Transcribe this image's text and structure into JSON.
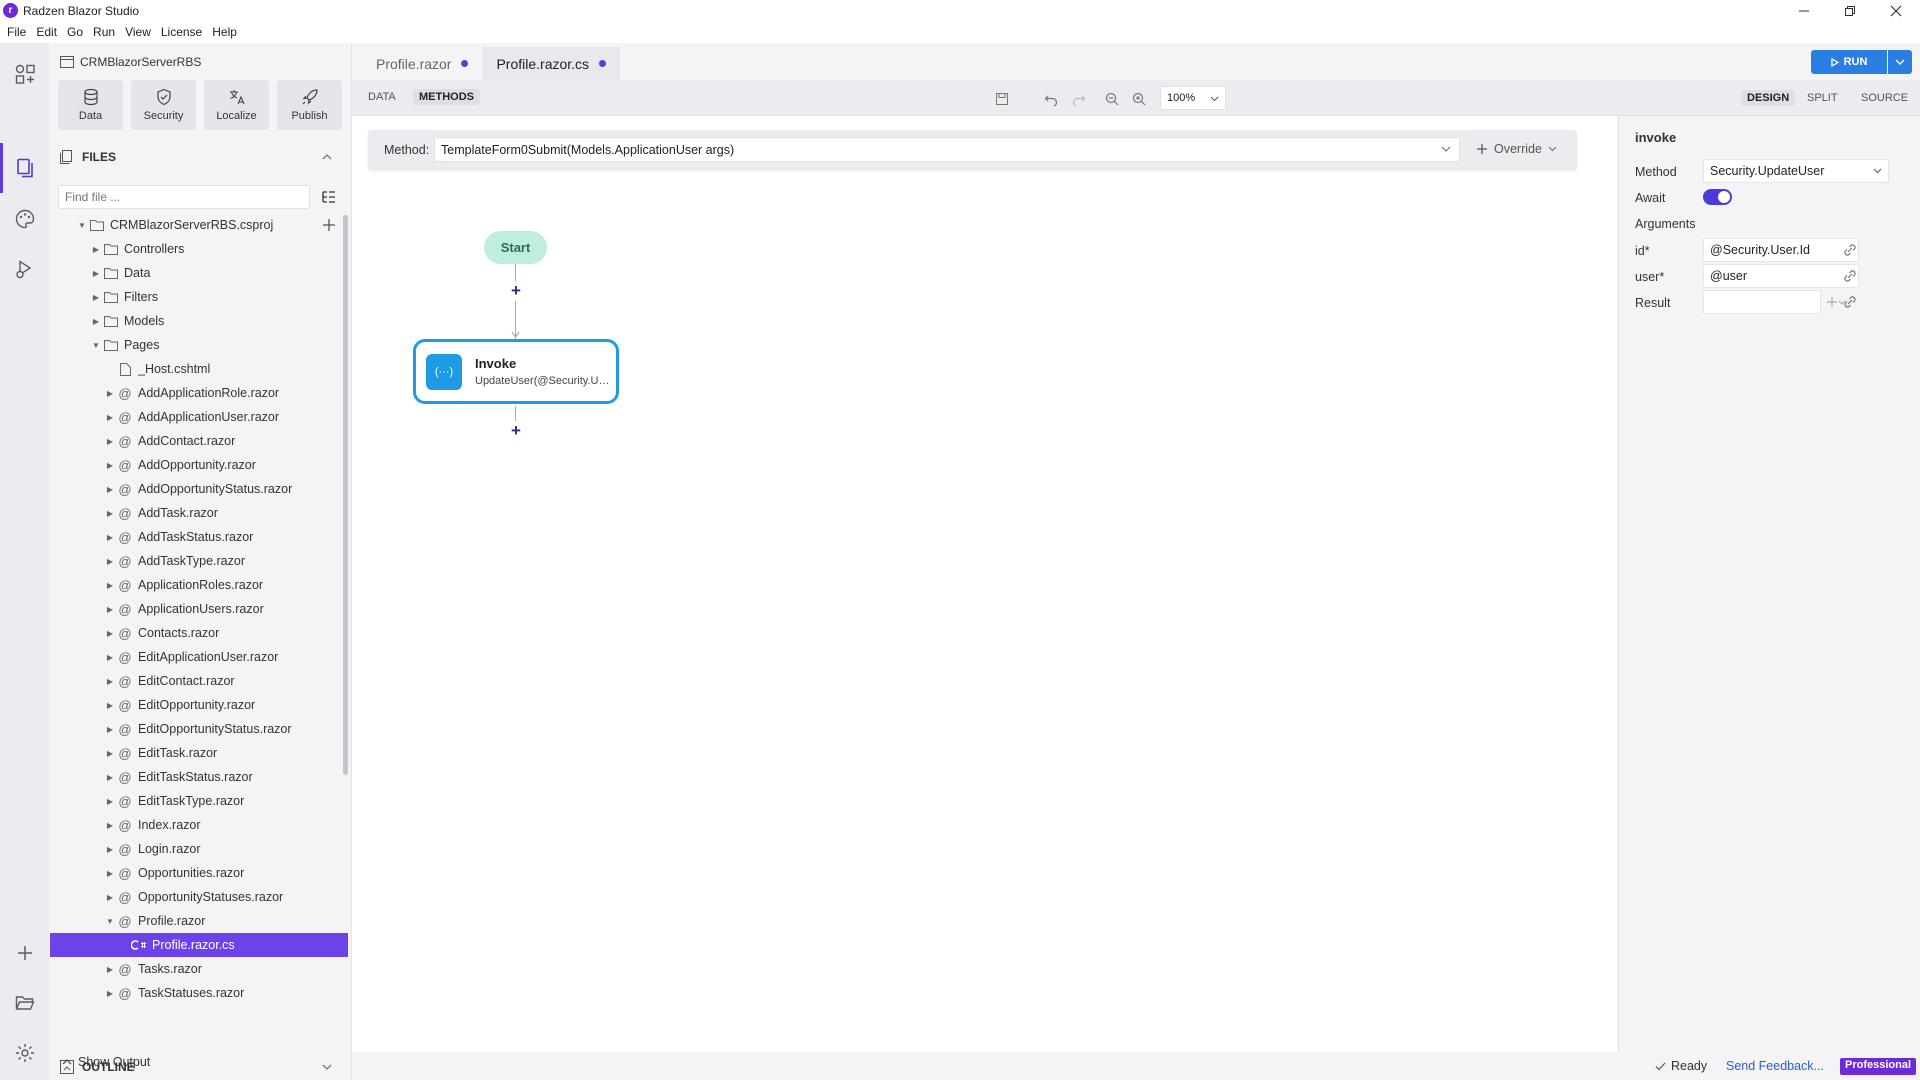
{
  "app": {
    "title": "Radzen Blazor Studio"
  },
  "menu": [
    "File",
    "Edit",
    "Go",
    "Run",
    "View",
    "License",
    "Help"
  ],
  "sidebar": {
    "project": "CRMBlazorServerRBS",
    "tools": [
      {
        "label": "Data",
        "icon": "database-icon"
      },
      {
        "label": "Security",
        "icon": "shield-icon"
      },
      {
        "label": "Localize",
        "icon": "translate-icon"
      },
      {
        "label": "Publish",
        "icon": "rocket-icon"
      }
    ],
    "files_header": "FILES",
    "find_placeholder": "Find file ...",
    "tree": [
      {
        "label": "CRMBlazorServerRBS.csproj",
        "kind": "project",
        "level": 0,
        "expanded": true
      },
      {
        "label": "Controllers",
        "kind": "folder",
        "level": 1
      },
      {
        "label": "Data",
        "kind": "folder",
        "level": 1
      },
      {
        "label": "Filters",
        "kind": "folder",
        "level": 1
      },
      {
        "label": "Models",
        "kind": "folder",
        "level": 1
      },
      {
        "label": "Pages",
        "kind": "folder",
        "level": 1,
        "expanded": true
      },
      {
        "label": "_Host.cshtml",
        "kind": "file",
        "level": 2
      },
      {
        "label": "AddApplicationRole.razor",
        "kind": "razor",
        "level": 2
      },
      {
        "label": "AddApplicationUser.razor",
        "kind": "razor",
        "level": 2
      },
      {
        "label": "AddContact.razor",
        "kind": "razor",
        "level": 2
      },
      {
        "label": "AddOpportunity.razor",
        "kind": "razor",
        "level": 2
      },
      {
        "label": "AddOpportunityStatus.razor",
        "kind": "razor",
        "level": 2
      },
      {
        "label": "AddTask.razor",
        "kind": "razor",
        "level": 2
      },
      {
        "label": "AddTaskStatus.razor",
        "kind": "razor",
        "level": 2
      },
      {
        "label": "AddTaskType.razor",
        "kind": "razor",
        "level": 2
      },
      {
        "label": "ApplicationRoles.razor",
        "kind": "razor",
        "level": 2
      },
      {
        "label": "ApplicationUsers.razor",
        "kind": "razor",
        "level": 2
      },
      {
        "label": "Contacts.razor",
        "kind": "razor",
        "level": 2
      },
      {
        "label": "EditApplicationUser.razor",
        "kind": "razor",
        "level": 2
      },
      {
        "label": "EditContact.razor",
        "kind": "razor",
        "level": 2
      },
      {
        "label": "EditOpportunity.razor",
        "kind": "razor",
        "level": 2
      },
      {
        "label": "EditOpportunityStatus.razor",
        "kind": "razor",
        "level": 2
      },
      {
        "label": "EditTask.razor",
        "kind": "razor",
        "level": 2
      },
      {
        "label": "EditTaskStatus.razor",
        "kind": "razor",
        "level": 2
      },
      {
        "label": "EditTaskType.razor",
        "kind": "razor",
        "level": 2
      },
      {
        "label": "Index.razor",
        "kind": "razor",
        "level": 2
      },
      {
        "label": "Login.razor",
        "kind": "razor",
        "level": 2
      },
      {
        "label": "Opportunities.razor",
        "kind": "razor",
        "level": 2
      },
      {
        "label": "OpportunityStatuses.razor",
        "kind": "razor",
        "level": 2
      },
      {
        "label": "Profile.razor",
        "kind": "razor",
        "level": 2,
        "expanded": true
      },
      {
        "label": "Profile.razor.cs",
        "kind": "cs",
        "level": 3,
        "selected": true
      },
      {
        "label": "Tasks.razor",
        "kind": "razor",
        "level": 2
      },
      {
        "label": "TaskStatuses.razor",
        "kind": "razor",
        "level": 2
      }
    ],
    "outline_header": "OUTLINE",
    "show_output": "Show Output"
  },
  "tabs": [
    {
      "label": "Profile.razor",
      "active": false
    },
    {
      "label": "Profile.razor.cs",
      "active": true
    }
  ],
  "run_label": "RUN",
  "subtabs": {
    "data": "DATA",
    "methods": "METHODS"
  },
  "zoom": "100%",
  "view_tabs": {
    "design": "DESIGN",
    "split": "SPLIT",
    "source": "SOURCE"
  },
  "method_bar": {
    "label": "Method:",
    "value": "TemplateForm0Submit(Models.ApplicationUser args)",
    "override": "Override"
  },
  "flow": {
    "start": "Start",
    "invoke_title": "Invoke",
    "invoke_sub": "UpdateUser(@Security.User.Id, @user)",
    "invoke_badge": "(···)"
  },
  "props": {
    "title": "invoke",
    "method_label": "Method",
    "method_value": "Security.UpdateUser",
    "await_label": "Await",
    "await_on": true,
    "arguments_label": "Arguments",
    "args": [
      {
        "name": "id*",
        "value": "@Security.User.Id"
      },
      {
        "name": "user*",
        "value": "@user"
      }
    ],
    "result_label": "Result",
    "result_value": ""
  },
  "status": {
    "ready": "Ready",
    "feedback": "Send Feedback...",
    "edition": "Professional"
  },
  "colors": {
    "accent": "#6c43e9",
    "run": "#2a7de1",
    "invoke": "#1f9be5",
    "start": "#bfeee0"
  }
}
